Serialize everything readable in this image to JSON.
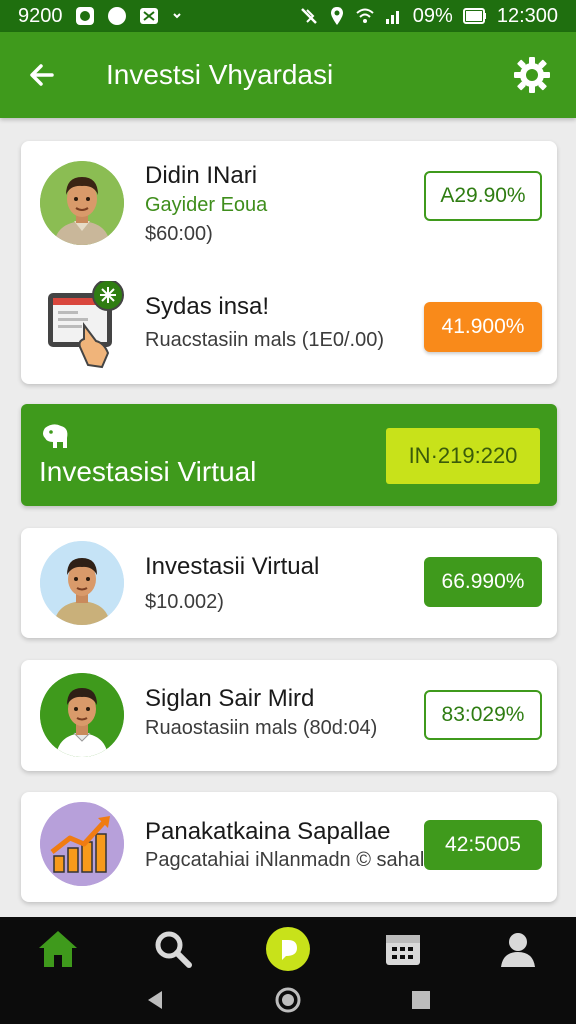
{
  "status_bar": {
    "time_left": "9200",
    "battery": "09%",
    "time_right": "12:300",
    "icons_left": [
      "whatsapp-icon",
      "circle-dot-icon",
      "missed-call-icon",
      "chevron-down-icon"
    ],
    "icons_right": [
      "mute-icon",
      "location-icon",
      "wifi-icon",
      "signal-icon",
      "battery-icon"
    ]
  },
  "app_bar": {
    "title": "Investsi Vhyardasi",
    "back_icon": "arrow-left-icon",
    "settings_icon": "gear-icon"
  },
  "top_card": {
    "items": [
      {
        "name": "Didin INari",
        "subtitle": "Gayider Eoua",
        "amount": "$60:00)",
        "value": "A29.90%",
        "icon": "avatar-man"
      },
      {
        "name": "Sydas insa!",
        "subtitle": "Ruacstasiin mals (1E0/.00)",
        "value": "41.900%",
        "icon": "tablet-hand-icon"
      }
    ]
  },
  "banner": {
    "title": "Investasisi Virtual",
    "badge": "IN·219:220",
    "icon": "elephant-icon"
  },
  "list": [
    {
      "name": "Investasii Virtual",
      "subtitle": "$10.002)",
      "value": "66.990%",
      "style": "solid"
    },
    {
      "name": "Siglan Sair Mird",
      "subtitle": "Ruaostasiin mals (80d:04)",
      "value": "83:029%",
      "style": "outline"
    },
    {
      "name": "Panakatkaina Sapallae",
      "subtitle": "Pagcatahiai iNlanmadn © sahal iyma",
      "value": "42:5005",
      "style": "solid"
    }
  ],
  "bottom_nav": [
    "home-icon",
    "search-icon",
    "play-circle-icon",
    "calendar-icon",
    "profile-icon"
  ],
  "system_nav": [
    "back-triangle-icon",
    "home-circle-icon",
    "recents-square-icon"
  ]
}
